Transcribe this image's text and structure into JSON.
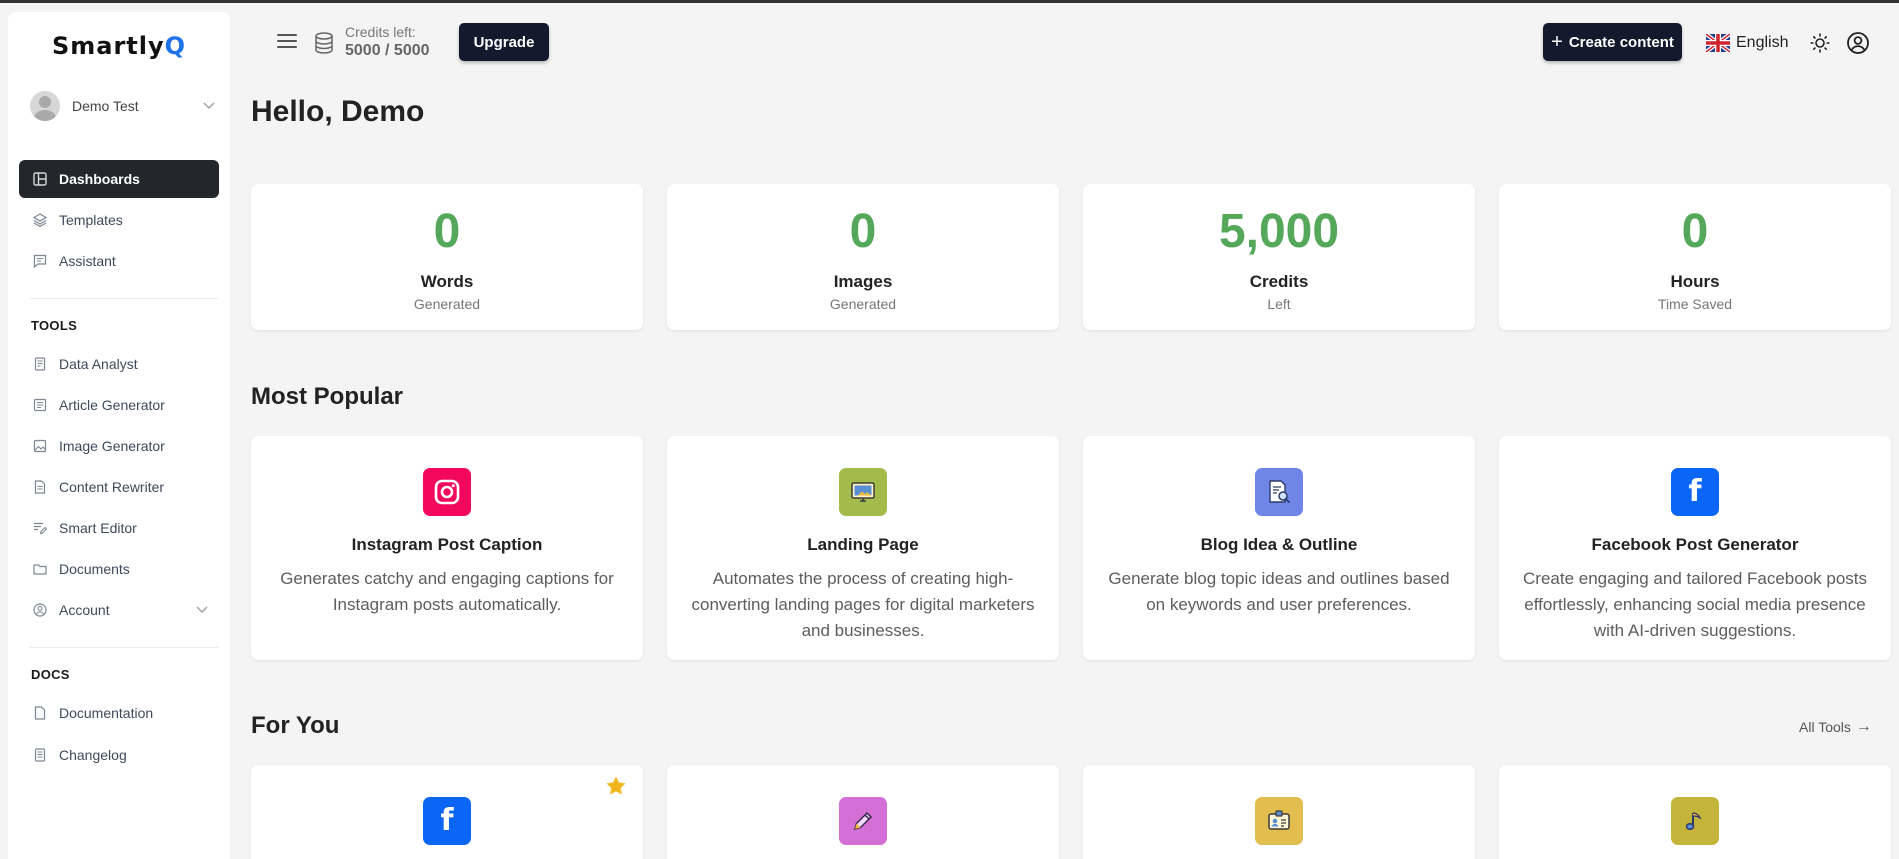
{
  "brand": {
    "name_main": "Smartly",
    "name_accent": "Q"
  },
  "user": {
    "name": "Demo Test"
  },
  "nav": {
    "primary": [
      {
        "label": "Dashboards",
        "icon": "dashboard-icon",
        "active": true
      },
      {
        "label": "Templates",
        "icon": "layers-icon"
      },
      {
        "label": "Assistant",
        "icon": "chat-icon"
      }
    ],
    "tools_heading": "TOOLS",
    "tools": [
      {
        "label": "Data Analyst",
        "icon": "report-icon"
      },
      {
        "label": "Article Generator",
        "icon": "article-icon"
      },
      {
        "label": "Image Generator",
        "icon": "image-icon"
      },
      {
        "label": "Content Rewriter",
        "icon": "document-icon"
      },
      {
        "label": "Smart Editor",
        "icon": "edit-lines-icon"
      },
      {
        "label": "Documents",
        "icon": "folder-icon"
      },
      {
        "label": "Account",
        "icon": "user-circle-icon"
      }
    ],
    "docs_heading": "DOCS",
    "docs": [
      {
        "label": "Documentation",
        "icon": "file-icon"
      },
      {
        "label": "Changelog",
        "icon": "changelog-icon"
      }
    ]
  },
  "topbar": {
    "credits_label": "Credits left:",
    "credits_value": "5000 / 5000",
    "upgrade_label": "Upgrade",
    "create_label": "Create content",
    "language": "English"
  },
  "greeting": "Hello, Demo",
  "stats": [
    {
      "value": "0",
      "label": "Words",
      "sub": "Generated"
    },
    {
      "value": "0",
      "label": "Images",
      "sub": "Generated"
    },
    {
      "value": "5,000",
      "label": "Credits",
      "sub": "Left"
    },
    {
      "value": "0",
      "label": "Hours",
      "sub": "Time Saved"
    }
  ],
  "most_popular": {
    "title": "Most Popular",
    "items": [
      {
        "name": "Instagram Post Caption",
        "desc": "Generates catchy and engaging captions for Instagram posts automatically.",
        "icon": "instagram-icon",
        "color": "#f2075e"
      },
      {
        "name": "Landing Page",
        "desc": "Automates the process of creating high-converting landing pages for digital marketers and businesses.",
        "icon": "monitor-icon",
        "color": "#a4bb4c"
      },
      {
        "name": "Blog Idea & Outline",
        "desc": "Generate blog topic ideas and outlines based on keywords and user preferences.",
        "icon": "blog-search-icon",
        "color": "#6f86e6"
      },
      {
        "name": "Facebook Post Generator",
        "desc": "Create engaging and tailored Facebook posts effortlessly, enhancing social media presence with AI-driven suggestions.",
        "icon": "facebook-icon",
        "color": "#0b66f5"
      }
    ]
  },
  "for_you": {
    "title": "For You",
    "all_tools_label": "All Tools",
    "items": [
      {
        "icon": "facebook-icon",
        "color": "#0b66f5",
        "starred": true
      },
      {
        "icon": "pencil-icon",
        "color": "#d46fd8"
      },
      {
        "icon": "id-card-icon",
        "color": "#e2bd4f"
      },
      {
        "icon": "music-note-icon",
        "color": "#c4b43a"
      }
    ]
  }
}
